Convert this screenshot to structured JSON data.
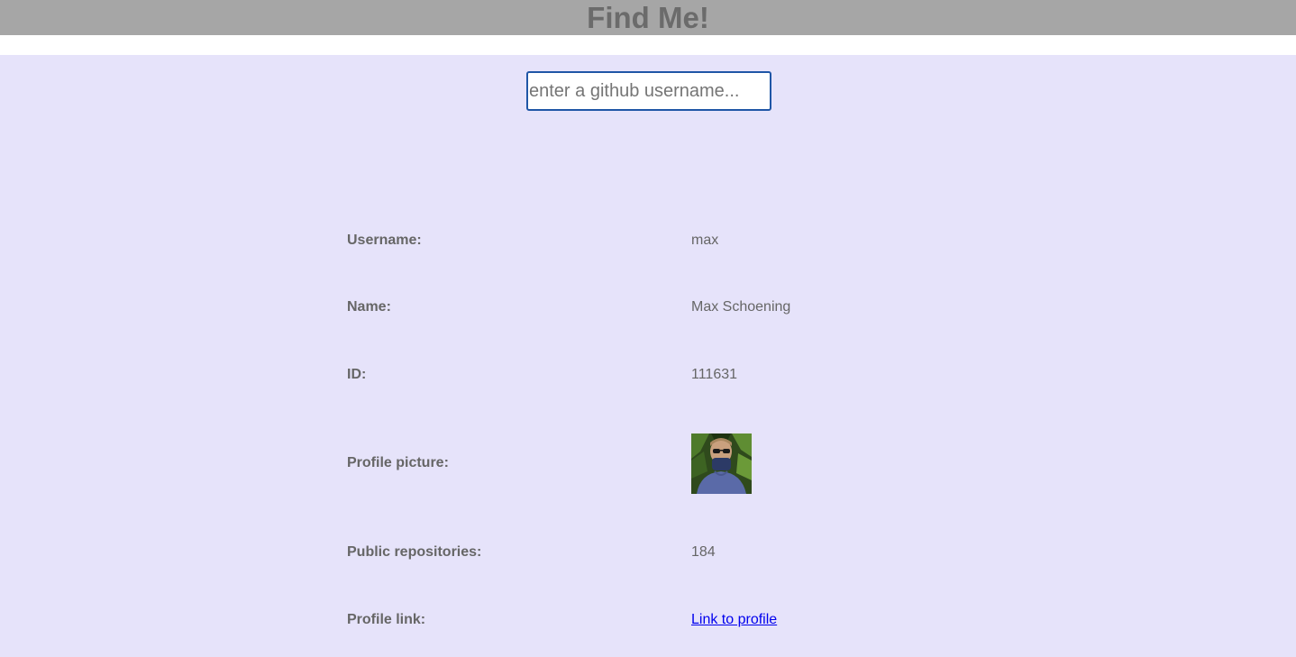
{
  "header": {
    "title": "Find Me!"
  },
  "search": {
    "placeholder": "enter a github username...",
    "value": ""
  },
  "profile": {
    "username_label": "Username:",
    "username_value": "max",
    "name_label": "Name:",
    "name_value": "Max Schoening",
    "id_label": "ID:",
    "id_value": "111631",
    "picture_label": "Profile picture:",
    "repos_label": "Public repositories:",
    "repos_value": "184",
    "link_label": "Profile link:",
    "link_text": "Link to profile"
  },
  "colors": {
    "header_bg": "#a6a6a6",
    "main_bg": "#e6e3fa",
    "text": "#666666",
    "link": "#0000ee",
    "input_border": "#1f56a6"
  }
}
